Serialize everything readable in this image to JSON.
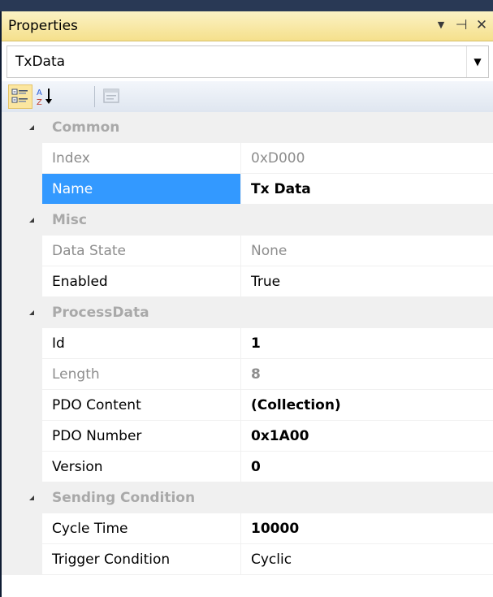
{
  "panel": {
    "title": "Properties"
  },
  "title_buttons": {
    "dropdown": "▼",
    "pin": "⊣",
    "close": "✕"
  },
  "selector": {
    "value": "TxData",
    "arrow": "▼"
  },
  "toolbar": {
    "buttons": [
      {
        "name": "categorized-view",
        "icon": "categorized-icon",
        "active": true
      },
      {
        "name": "alphabetical-view",
        "icon": "sort-az-icon",
        "active": false
      },
      {
        "name": "property-pages",
        "icon": "property-pages-icon",
        "active": false
      }
    ]
  },
  "grid": {
    "sections": [
      {
        "label": "Common",
        "rows": [
          {
            "name": "Index",
            "value": "0xD000",
            "readonly": true,
            "bold": false,
            "selected": false
          },
          {
            "name": "Name",
            "value": "Tx Data",
            "readonly": false,
            "bold": true,
            "selected": true
          }
        ]
      },
      {
        "label": "Misc",
        "rows": [
          {
            "name": "Data State",
            "value": "None",
            "readonly": true,
            "bold": false,
            "selected": false
          },
          {
            "name": "Enabled",
            "value": "True",
            "readonly": false,
            "bold": false,
            "selected": false
          }
        ]
      },
      {
        "label": "ProcessData",
        "rows": [
          {
            "name": "Id",
            "value": "1",
            "readonly": false,
            "bold": true,
            "selected": false
          },
          {
            "name": "Length",
            "value": "8",
            "readonly": true,
            "bold": true,
            "selected": false
          },
          {
            "name": "PDO Content",
            "value": "(Collection)",
            "readonly": false,
            "bold": true,
            "selected": false
          },
          {
            "name": "PDO Number",
            "value": "0x1A00",
            "readonly": false,
            "bold": true,
            "selected": false
          },
          {
            "name": "Version",
            "value": "0",
            "readonly": false,
            "bold": true,
            "selected": false
          }
        ]
      },
      {
        "label": "Sending Condition",
        "rows": [
          {
            "name": "Cycle Time",
            "value": "10000",
            "readonly": false,
            "bold": true,
            "selected": false
          },
          {
            "name": "Trigger Condition",
            "value": "Cyclic",
            "readonly": false,
            "bold": false,
            "selected": false
          }
        ]
      }
    ]
  },
  "colors": {
    "titlebar": "#f5e08c",
    "selection": "#3399ff",
    "category_text": "#a9a9a9",
    "readonly_text": "#8d8d8d"
  }
}
